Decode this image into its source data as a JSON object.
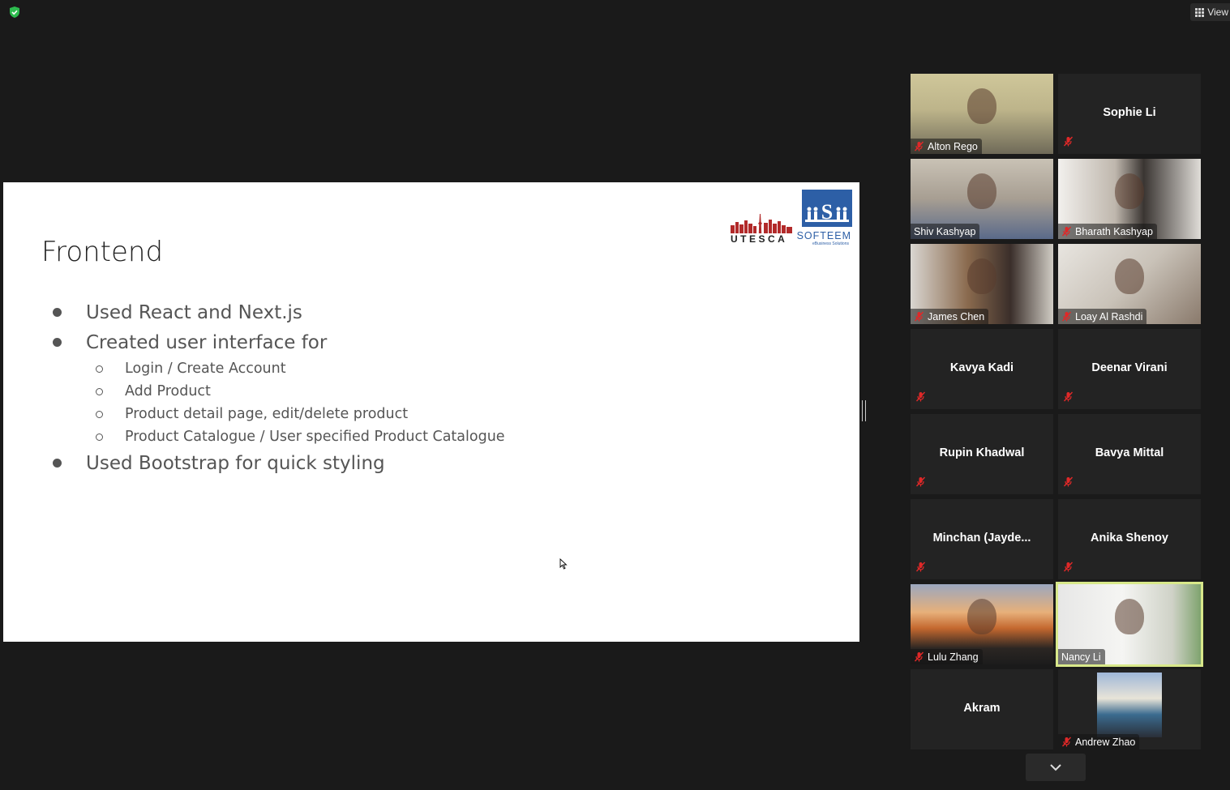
{
  "window": {
    "view_label": "View",
    "colors": {
      "background": "#1a1a1a",
      "tile": "#232323",
      "active_speaker": "#d8e88a",
      "mute": "#e02828",
      "shield": "#2dbb4e"
    }
  },
  "slide": {
    "logo_left": "UTESCA",
    "logo_right": "SOFTEEM",
    "logo_right_sub": "eBusiness Solutions",
    "title": "Frontend",
    "bullets": [
      {
        "level": 1,
        "text": "Used React and Next.js"
      },
      {
        "level": 1,
        "text": "Created user interface for"
      },
      {
        "level": 2,
        "text": "Login / Create Account"
      },
      {
        "level": 2,
        "text": "Add Product"
      },
      {
        "level": 2,
        "text": "Product detail page, edit/delete product"
      },
      {
        "level": 2,
        "text": "Product Catalogue / User specified Product Catalogue"
      },
      {
        "level": 1,
        "text": "Used Bootstrap for quick styling"
      }
    ]
  },
  "participants": [
    {
      "name": "Alton Rego",
      "video": true,
      "muted": true,
      "active": false
    },
    {
      "name": "Sophie Li",
      "video": false,
      "muted": true,
      "active": false
    },
    {
      "name": "Shiv Kashyap",
      "video": true,
      "muted": false,
      "active": false
    },
    {
      "name": "Bharath Kashyap",
      "video": true,
      "muted": true,
      "active": false
    },
    {
      "name": "James Chen",
      "video": true,
      "muted": true,
      "active": false
    },
    {
      "name": "Loay Al Rashdi",
      "video": true,
      "muted": true,
      "active": false
    },
    {
      "name": "Kavya Kadi",
      "video": false,
      "muted": true,
      "active": false
    },
    {
      "name": "Deenar Virani",
      "video": false,
      "muted": true,
      "active": false
    },
    {
      "name": "Rupin Khadwal",
      "video": false,
      "muted": true,
      "active": false
    },
    {
      "name": "Bavya Mittal",
      "video": false,
      "muted": true,
      "active": false
    },
    {
      "name": "Minchan  (Jayde...",
      "video": false,
      "muted": true,
      "active": false
    },
    {
      "name": "Anika Shenoy",
      "video": false,
      "muted": true,
      "active": false
    },
    {
      "name": "Lulu Zhang",
      "video": true,
      "muted": true,
      "active": false
    },
    {
      "name": "Nancy Li",
      "video": true,
      "muted": false,
      "active": true
    },
    {
      "name": "Akram",
      "video": false,
      "muted": false,
      "active": false
    },
    {
      "name": "Andrew Zhao",
      "video": true,
      "muted": true,
      "active": false
    }
  ]
}
